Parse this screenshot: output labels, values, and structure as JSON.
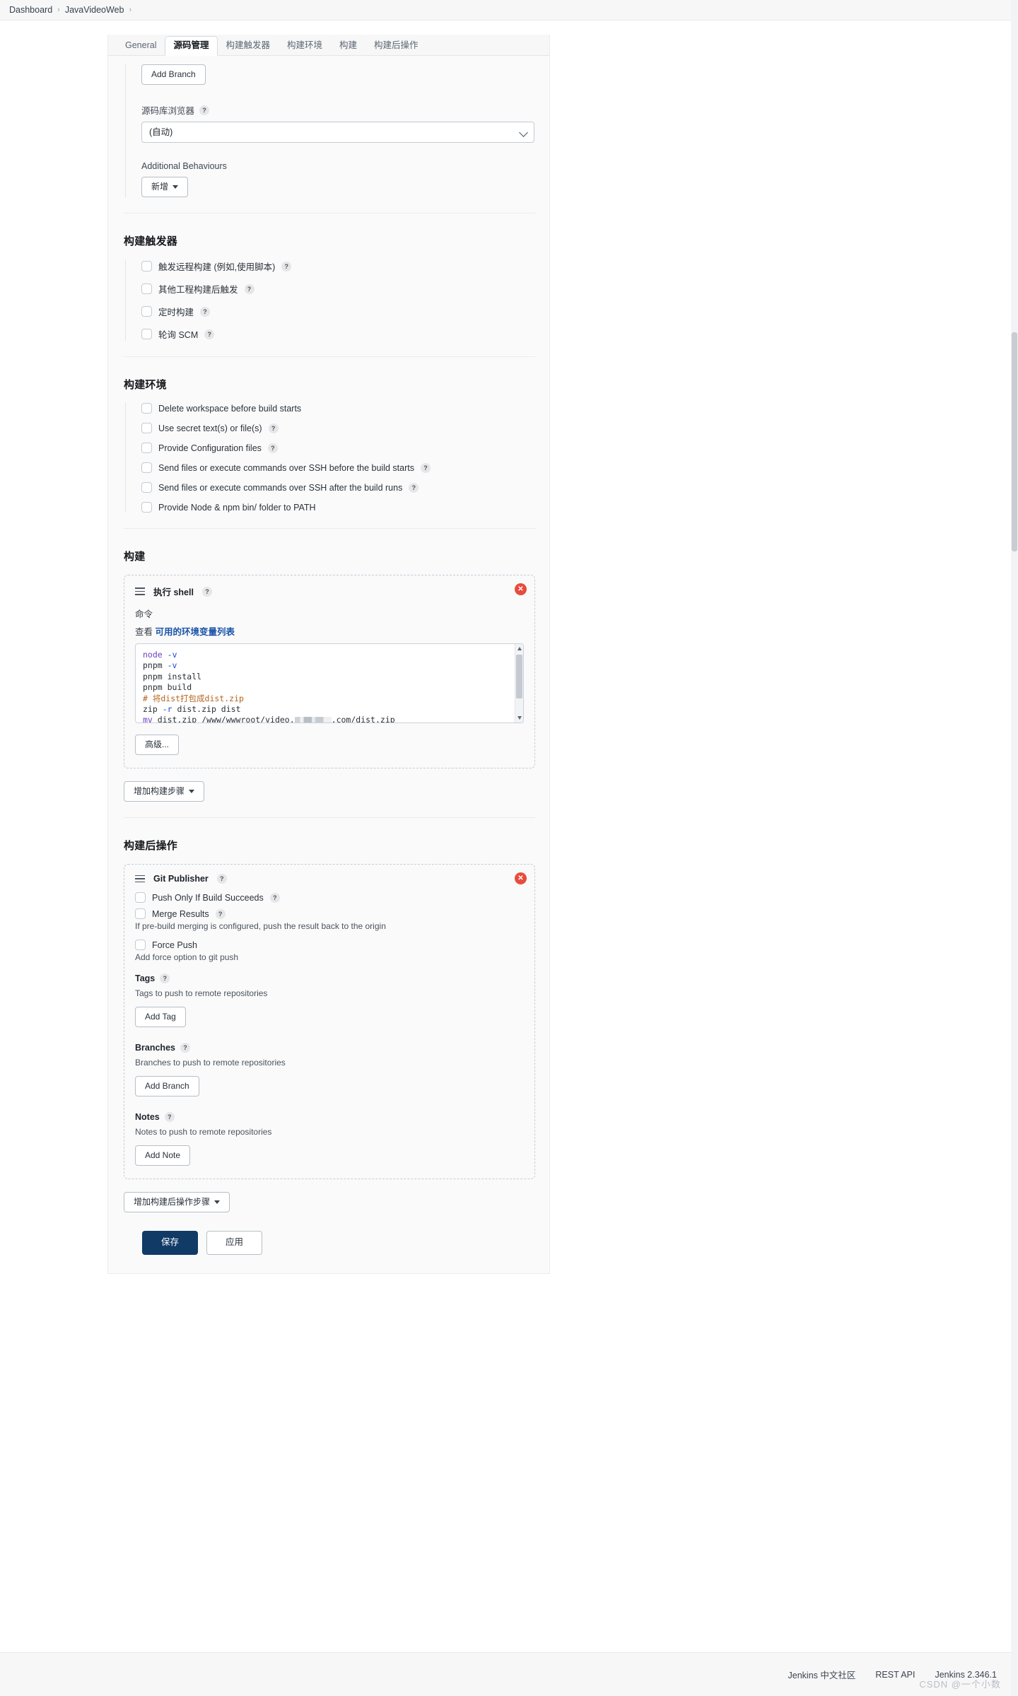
{
  "breadcrumb": {
    "items": [
      "Dashboard",
      "JavaVideoWeb"
    ],
    "separator": "›"
  },
  "tabs": [
    {
      "label": "General",
      "active": false
    },
    {
      "label": "源码管理",
      "active": true
    },
    {
      "label": "构建触发器",
      "active": false
    },
    {
      "label": "构建环境",
      "active": false
    },
    {
      "label": "构建",
      "active": false
    },
    {
      "label": "构建后操作",
      "active": false
    }
  ],
  "scm": {
    "add_branch_label": "Add Branch",
    "repo_browser_label": "源码库浏览器",
    "repo_browser_value": "(自动)",
    "repo_browser_options": [
      "(自动)"
    ],
    "additional_behaviours_label": "Additional Behaviours",
    "add_behaviour_label": "新增"
  },
  "triggers": {
    "title": "构建触发器",
    "items": [
      {
        "label": "触发远程构建 (例如,使用脚本)",
        "checked": false,
        "help": true
      },
      {
        "label": "其他工程构建后触发",
        "checked": false,
        "help": true
      },
      {
        "label": "定时构建",
        "checked": false,
        "help": true
      },
      {
        "label": "轮询 SCM",
        "checked": false,
        "help": true
      }
    ]
  },
  "environment": {
    "title": "构建环境",
    "items": [
      {
        "label": "Delete workspace before build starts",
        "checked": false,
        "help": false
      },
      {
        "label": "Use secret text(s) or file(s)",
        "checked": false,
        "help": true
      },
      {
        "label": "Provide Configuration files",
        "checked": false,
        "help": true
      },
      {
        "label": "Send files or execute commands over SSH before the build starts",
        "checked": false,
        "help": true
      },
      {
        "label": "Send files or execute commands over SSH after the build runs",
        "checked": false,
        "help": true
      },
      {
        "label": "Provide Node & npm bin/ folder to PATH",
        "checked": false,
        "help": false
      }
    ]
  },
  "build": {
    "title": "构建",
    "step_title": "执行 shell",
    "command_label": "命令",
    "see_prefix": "查看",
    "see_link": "可用的环境变量列表",
    "script_lines": [
      {
        "text": "node -v",
        "cmd": "node",
        "rest": " -v"
      },
      {
        "text": "pnpm -v"
      },
      {
        "text": "pnpm install"
      },
      {
        "text": "pnpm build"
      },
      {
        "text": "# 将dist打包成dist.zip"
      },
      {
        "text": "zip -r dist.zip dist"
      },
      {
        "text": "mv dist.zip /www/wwwroot/video.███.com/dist.zip"
      }
    ],
    "advanced_label": "高级...",
    "add_step_label": "增加构建步骤",
    "close_label": "✕"
  },
  "post_build": {
    "title": "构建后操作",
    "step_title": "Git Publisher",
    "close_label": "✕",
    "options": [
      {
        "label": "Push Only If Build Succeeds",
        "checked": false,
        "help": true,
        "desc": ""
      },
      {
        "label": "Merge Results",
        "checked": false,
        "help": true,
        "desc": "If pre-build merging is configured, push the result back to the origin"
      },
      {
        "label": "Force Push",
        "checked": false,
        "help": false,
        "desc": "Add force option to git push"
      }
    ],
    "groups": [
      {
        "label": "Tags",
        "help": true,
        "desc": "Tags to push to remote repositories",
        "button": "Add Tag"
      },
      {
        "label": "Branches",
        "help": true,
        "desc": "Branches to push to remote repositories",
        "button": "Add Branch"
      },
      {
        "label": "Notes",
        "help": true,
        "desc": "Notes to push to remote repositories",
        "button": "Add Note"
      }
    ],
    "add_action_label": "增加构建后操作步骤"
  },
  "actions": {
    "save_label": "保存",
    "apply_label": "应用"
  },
  "footer": {
    "community": "Jenkins 中文社区",
    "rest_api": "REST API",
    "version": "Jenkins 2.346.1",
    "watermark": "CSDN @一个小数"
  },
  "colors": {
    "primary": "#113a66",
    "link": "#1a53a8",
    "danger": "#e74c3c"
  }
}
